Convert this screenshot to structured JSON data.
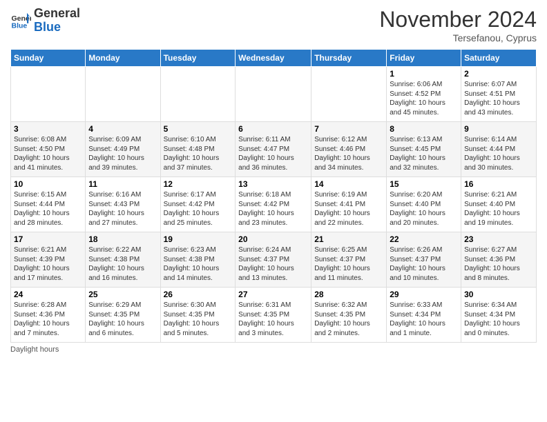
{
  "header": {
    "logo_general": "General",
    "logo_blue": "Blue",
    "month_title": "November 2024",
    "subtitle": "Tersefanou, Cyprus"
  },
  "days_of_week": [
    "Sunday",
    "Monday",
    "Tuesday",
    "Wednesday",
    "Thursday",
    "Friday",
    "Saturday"
  ],
  "weeks": [
    [
      {
        "day": "",
        "info": ""
      },
      {
        "day": "",
        "info": ""
      },
      {
        "day": "",
        "info": ""
      },
      {
        "day": "",
        "info": ""
      },
      {
        "day": "",
        "info": ""
      },
      {
        "day": "1",
        "info": "Sunrise: 6:06 AM\nSunset: 4:52 PM\nDaylight: 10 hours\nand 45 minutes."
      },
      {
        "day": "2",
        "info": "Sunrise: 6:07 AM\nSunset: 4:51 PM\nDaylight: 10 hours\nand 43 minutes."
      }
    ],
    [
      {
        "day": "3",
        "info": "Sunrise: 6:08 AM\nSunset: 4:50 PM\nDaylight: 10 hours\nand 41 minutes."
      },
      {
        "day": "4",
        "info": "Sunrise: 6:09 AM\nSunset: 4:49 PM\nDaylight: 10 hours\nand 39 minutes."
      },
      {
        "day": "5",
        "info": "Sunrise: 6:10 AM\nSunset: 4:48 PM\nDaylight: 10 hours\nand 37 minutes."
      },
      {
        "day": "6",
        "info": "Sunrise: 6:11 AM\nSunset: 4:47 PM\nDaylight: 10 hours\nand 36 minutes."
      },
      {
        "day": "7",
        "info": "Sunrise: 6:12 AM\nSunset: 4:46 PM\nDaylight: 10 hours\nand 34 minutes."
      },
      {
        "day": "8",
        "info": "Sunrise: 6:13 AM\nSunset: 4:45 PM\nDaylight: 10 hours\nand 32 minutes."
      },
      {
        "day": "9",
        "info": "Sunrise: 6:14 AM\nSunset: 4:44 PM\nDaylight: 10 hours\nand 30 minutes."
      }
    ],
    [
      {
        "day": "10",
        "info": "Sunrise: 6:15 AM\nSunset: 4:44 PM\nDaylight: 10 hours\nand 28 minutes."
      },
      {
        "day": "11",
        "info": "Sunrise: 6:16 AM\nSunset: 4:43 PM\nDaylight: 10 hours\nand 27 minutes."
      },
      {
        "day": "12",
        "info": "Sunrise: 6:17 AM\nSunset: 4:42 PM\nDaylight: 10 hours\nand 25 minutes."
      },
      {
        "day": "13",
        "info": "Sunrise: 6:18 AM\nSunset: 4:42 PM\nDaylight: 10 hours\nand 23 minutes."
      },
      {
        "day": "14",
        "info": "Sunrise: 6:19 AM\nSunset: 4:41 PM\nDaylight: 10 hours\nand 22 minutes."
      },
      {
        "day": "15",
        "info": "Sunrise: 6:20 AM\nSunset: 4:40 PM\nDaylight: 10 hours\nand 20 minutes."
      },
      {
        "day": "16",
        "info": "Sunrise: 6:21 AM\nSunset: 4:40 PM\nDaylight: 10 hours\nand 19 minutes."
      }
    ],
    [
      {
        "day": "17",
        "info": "Sunrise: 6:21 AM\nSunset: 4:39 PM\nDaylight: 10 hours\nand 17 minutes."
      },
      {
        "day": "18",
        "info": "Sunrise: 6:22 AM\nSunset: 4:38 PM\nDaylight: 10 hours\nand 16 minutes."
      },
      {
        "day": "19",
        "info": "Sunrise: 6:23 AM\nSunset: 4:38 PM\nDaylight: 10 hours\nand 14 minutes."
      },
      {
        "day": "20",
        "info": "Sunrise: 6:24 AM\nSunset: 4:37 PM\nDaylight: 10 hours\nand 13 minutes."
      },
      {
        "day": "21",
        "info": "Sunrise: 6:25 AM\nSunset: 4:37 PM\nDaylight: 10 hours\nand 11 minutes."
      },
      {
        "day": "22",
        "info": "Sunrise: 6:26 AM\nSunset: 4:37 PM\nDaylight: 10 hours\nand 10 minutes."
      },
      {
        "day": "23",
        "info": "Sunrise: 6:27 AM\nSunset: 4:36 PM\nDaylight: 10 hours\nand 8 minutes."
      }
    ],
    [
      {
        "day": "24",
        "info": "Sunrise: 6:28 AM\nSunset: 4:36 PM\nDaylight: 10 hours\nand 7 minutes."
      },
      {
        "day": "25",
        "info": "Sunrise: 6:29 AM\nSunset: 4:35 PM\nDaylight: 10 hours\nand 6 minutes."
      },
      {
        "day": "26",
        "info": "Sunrise: 6:30 AM\nSunset: 4:35 PM\nDaylight: 10 hours\nand 5 minutes."
      },
      {
        "day": "27",
        "info": "Sunrise: 6:31 AM\nSunset: 4:35 PM\nDaylight: 10 hours\nand 3 minutes."
      },
      {
        "day": "28",
        "info": "Sunrise: 6:32 AM\nSunset: 4:35 PM\nDaylight: 10 hours\nand 2 minutes."
      },
      {
        "day": "29",
        "info": "Sunrise: 6:33 AM\nSunset: 4:34 PM\nDaylight: 10 hours\nand 1 minute."
      },
      {
        "day": "30",
        "info": "Sunrise: 6:34 AM\nSunset: 4:34 PM\nDaylight: 10 hours\nand 0 minutes."
      }
    ]
  ],
  "footer": {
    "note": "Daylight hours"
  }
}
